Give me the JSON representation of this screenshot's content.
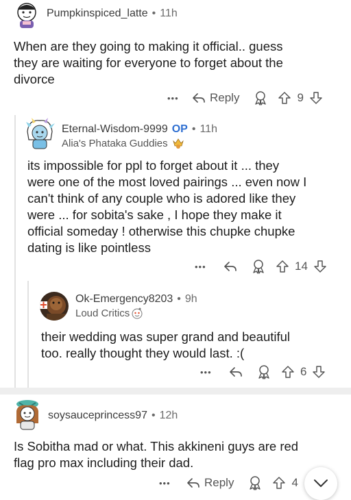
{
  "comments": [
    {
      "username": "Pumpkinspiced_latte",
      "time": "11h",
      "body": [
        "When are they going to making it official.. guess",
        "they are waiting for everyone to forget about the",
        "divorce"
      ],
      "reply_label": "Reply",
      "votes": "9"
    },
    {
      "username": "Eternal-Wisdom-9999",
      "op_badge": "OP",
      "time": "11h",
      "flair": "Alia's Phataka Guddies",
      "body": [
        "its impossible for ppl to forget about it ... they",
        "were one of the most loved pairings ... even now I",
        "can't think of any couple who is adored like they",
        "were ... for sobita's sake , I hope they make it",
        "official someday ! otherwise this chupke chupke",
        "dating is like pointless"
      ],
      "votes": "14"
    },
    {
      "username": "Ok-Emergency8203",
      "time": "9h",
      "flair": "Loud Critics",
      "body": [
        "their wedding was super grand and beautiful",
        "too. really thought they would last. :("
      ],
      "votes": "6"
    },
    {
      "username": "soysauceprincess97",
      "time": "12h",
      "body": [
        "Is Sobitha mad or what. This akkineni guys are red",
        "flag pro max including their dad."
      ],
      "reply_label": "Reply",
      "votes": "4"
    }
  ],
  "separator": "•",
  "more_glyph": "•••",
  "colors": {
    "op": "#2f6fd1",
    "text": "#1c1c1c",
    "meta": "#6b6b6b",
    "divider": "#eeeeee"
  },
  "icons": [
    "more-icon",
    "reply-arrow-icon",
    "award-icon",
    "upvote-icon",
    "downvote-icon",
    "chevron-down-icon"
  ]
}
